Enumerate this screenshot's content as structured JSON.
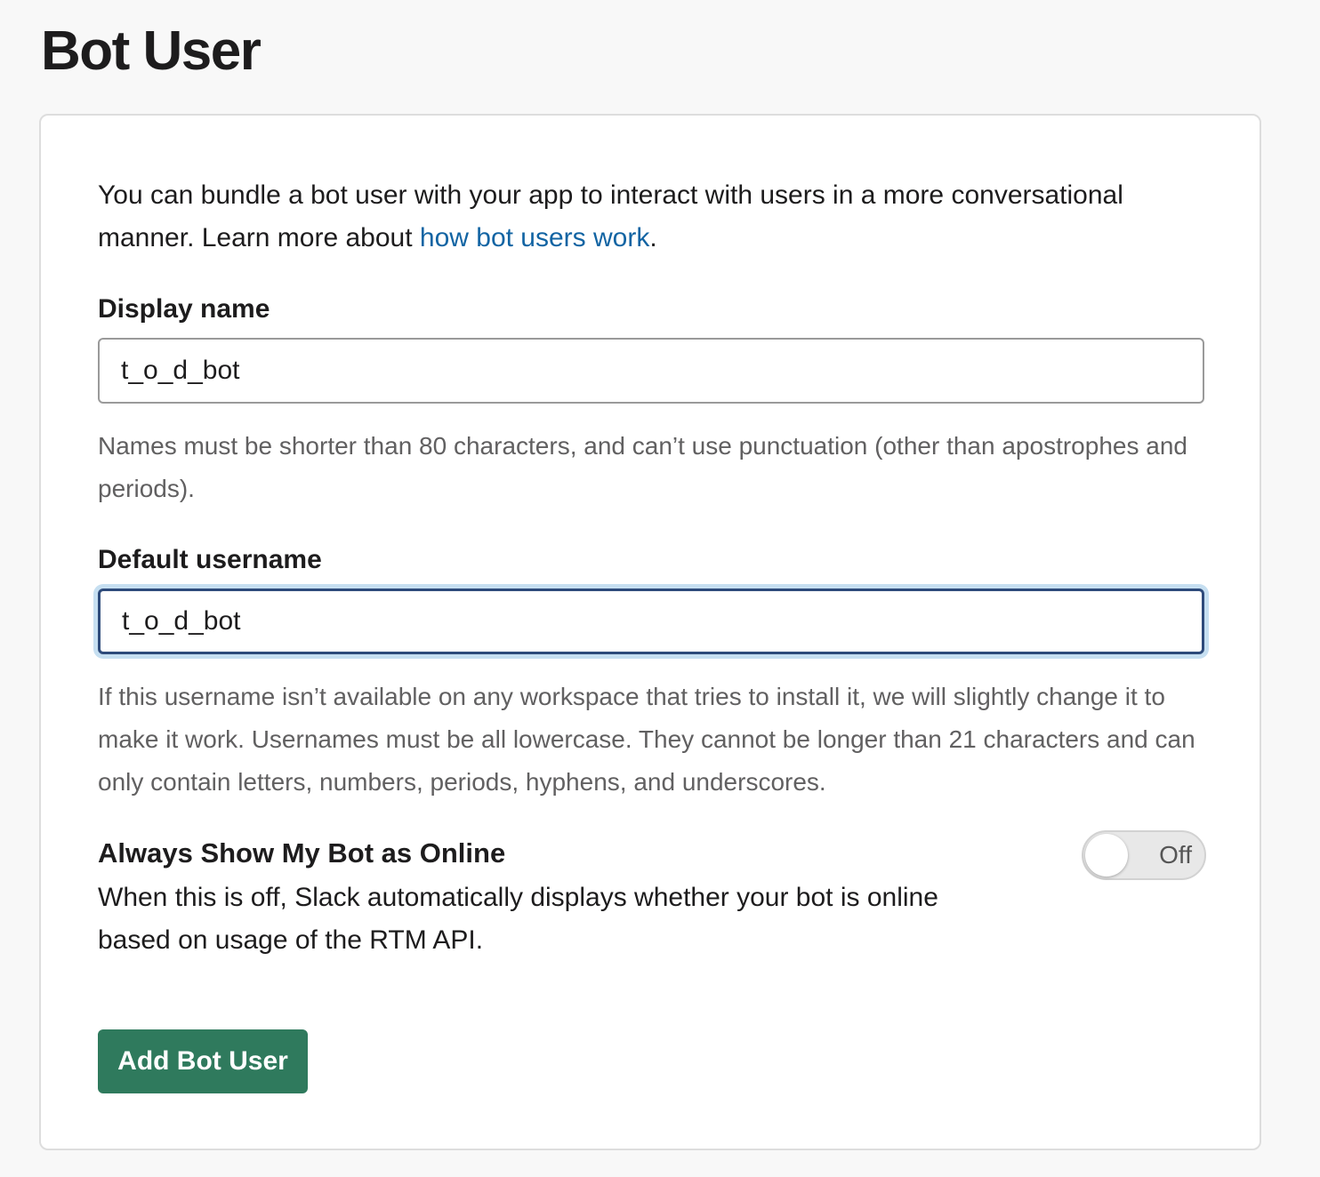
{
  "page": {
    "title": "Bot User"
  },
  "intro": {
    "text": "You can bundle a bot user with your app to interact with users in a more conversational manner. Learn more about ",
    "link_text": "how bot users work",
    "suffix": "."
  },
  "display_name": {
    "label": "Display name",
    "value": "t_o_d_bot",
    "help": "Names must be shorter than 80 characters, and can’t use punctuation (other than apostrophes and periods)."
  },
  "default_username": {
    "label": "Default username",
    "value": "t_o_d_bot",
    "help": "If this username isn’t available on any workspace that tries to install it, we will slightly change it to make it work. Usernames must be all lowercase. They cannot be longer than 21 characters and can only contain letters, numbers, periods, hyphens, and underscores."
  },
  "online_toggle": {
    "title": "Always Show My Bot as Online",
    "description": "When this is off, Slack automatically displays whether your bot is online based on usage of the RTM API.",
    "state_label": "Off"
  },
  "actions": {
    "add_label": "Add Bot User"
  },
  "colors": {
    "link": "#1264a3",
    "primary_button": "#2f7a5d",
    "focus_ring": "#c6dff1"
  }
}
